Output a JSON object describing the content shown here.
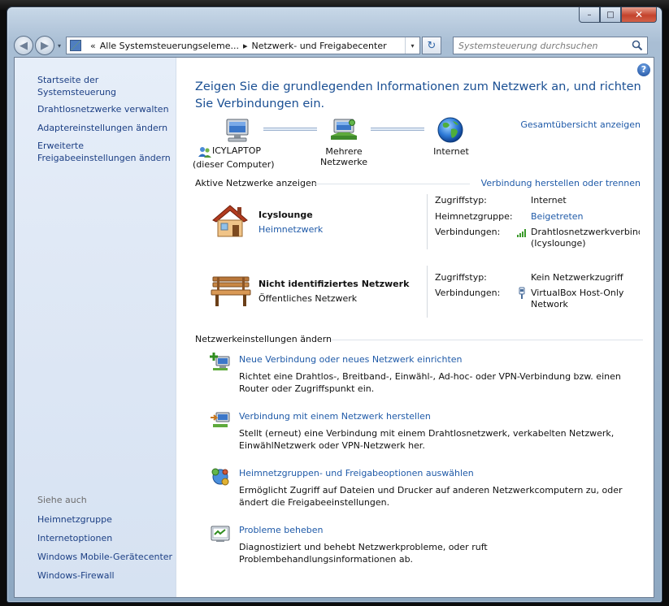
{
  "window": {
    "minimize_glyph": "–",
    "maximize_glyph": "□",
    "close_glyph": "✕"
  },
  "navigation": {
    "back_glyph": "◀",
    "forward_glyph": "▶",
    "dropdown_glyph": "▾",
    "breadcrumb_prefix": "«",
    "breadcrumb_sep": "▸",
    "breadcrumbs": [
      "Alle Systemsteuerungseleme...",
      "Netzwerk- und Freigabecenter"
    ],
    "refresh_glyph": "↻",
    "search_placeholder": "Systemsteuerung durchsuchen"
  },
  "sidebar": {
    "home_link": "Startseite der Systemsteuerung",
    "links": [
      "Drahtlosnetzwerke verwalten",
      "Adaptereinstellungen ändern",
      "Erweiterte\nFreigabeeinstellungen ändern"
    ],
    "see_also_heading": "Siehe auch",
    "see_also": [
      "Heimnetzgruppe",
      "Internetoptionen",
      "Windows Mobile-Gerätecenter",
      "Windows-Firewall"
    ]
  },
  "main": {
    "help_glyph": "?",
    "title": "Zeigen Sie die grundlegenden Informationen zum Netzwerk an, und richten Sie Verbindungen ein.",
    "overview_link": "Gesamtübersicht anzeigen",
    "map": {
      "computer_name": "ICYLAPTOP",
      "computer_sub": "(dieser Computer)",
      "network_label": "Mehrere Netzwerke",
      "internet_label": "Internet"
    },
    "active_networks": {
      "heading": "Aktive Netzwerke anzeigen",
      "connect_link": "Verbindung herstellen oder trennen",
      "networks": [
        {
          "name": "Icyslounge",
          "type": "Heimnetzwerk",
          "access_type_label": "Zugriffstyp:",
          "access_type": "Internet",
          "homegroup_label": "Heimnetzgruppe:",
          "homegroup": "Beigetreten",
          "connections_label": "Verbindungen:",
          "connection": "Drahtlosnetzwerkverbindu\n(Icyslounge)"
        },
        {
          "name": "Nicht identifiziertes Netzwerk",
          "type": "Öffentliches Netzwerk",
          "access_type_label": "Zugriffstyp:",
          "access_type": "Kein Netzwerkzugriff",
          "connections_label": "Verbindungen:",
          "connection": "VirtualBox Host-Only\nNetwork"
        }
      ]
    },
    "settings": {
      "heading": "Netzwerkeinstellungen ändern",
      "tasks": [
        {
          "title": "Neue Verbindung oder neues Netzwerk einrichten",
          "desc": "Richtet eine Drahtlos-, Breitband-, Einwähl-, Ad-hoc- oder VPN-Verbindung bzw. einen Router oder Zugriffspunkt ein."
        },
        {
          "title": "Verbindung mit einem Netzwerk herstellen",
          "desc": "Stellt (erneut) eine Verbindung mit einem Drahtlosnetzwerk, verkabelten Netzwerk, EinwählNetzwerk oder VPN-Netzwerk her."
        },
        {
          "title": "Heimnetzgruppen- und Freigabeoptionen auswählen",
          "desc": "Ermöglicht Zugriff auf Dateien und Drucker auf anderen Netzwerkcomputern zu, oder ändert die Freigabeeinstellungen."
        },
        {
          "title": "Probleme beheben",
          "desc": "Diagnostiziert und behebt Netzwerkprobleme, oder ruft Problembehandlungsinformationen ab."
        }
      ]
    }
  }
}
